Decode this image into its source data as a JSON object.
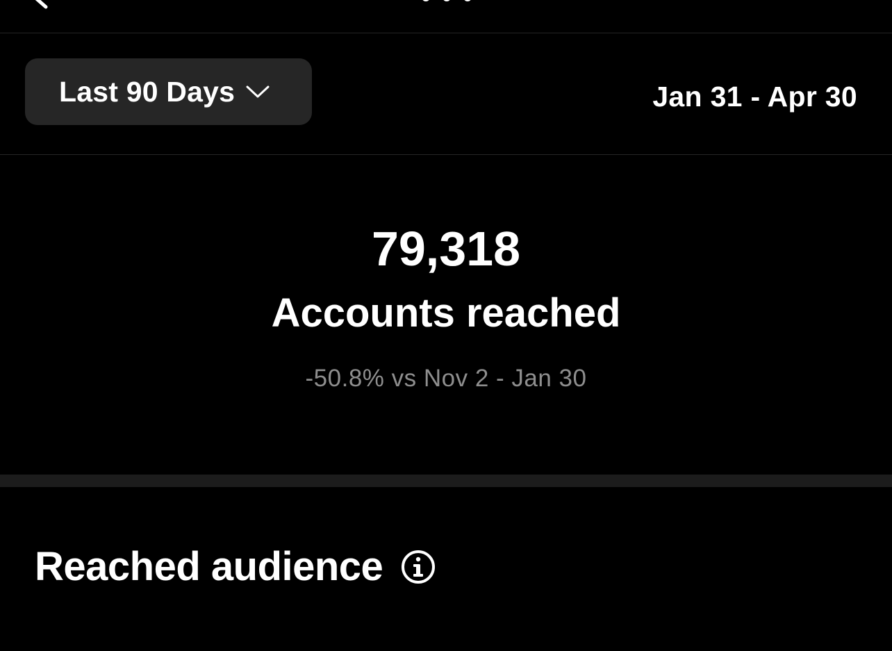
{
  "filter": {
    "period_label": "Last 90 Days",
    "date_range": "Jan 31 - Apr 30"
  },
  "summary": {
    "value": "79,318",
    "label": "Accounts reached",
    "comparison": "-50.8% vs Nov 2 - Jan 30"
  },
  "section": {
    "title": "Reached audience"
  },
  "icons": {
    "back": "chevron-left-icon",
    "more": "more-dots-icon",
    "dropdown": "chevron-down-icon",
    "info": "info-icon"
  },
  "colors": {
    "background": "#000000",
    "button_bg": "#262626",
    "text": "#ffffff",
    "muted_text": "#8e8e8e",
    "divider": "#1c1c1c"
  }
}
